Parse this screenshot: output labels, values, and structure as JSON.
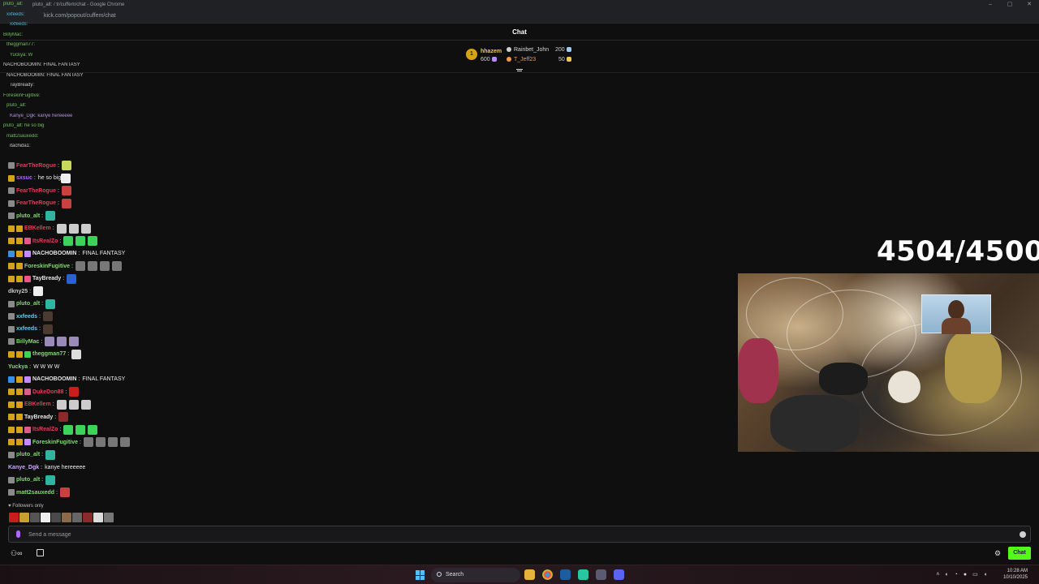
{
  "browser": {
    "window_title": "pluto_alt: / tr/cuffem/chat - Google Chrome",
    "url": "kick.com/popout/cuffem/chat",
    "controls": [
      "–",
      "▢",
      "✕"
    ]
  },
  "chat": {
    "title": "Chat",
    "leaderboard": {
      "rank": "1",
      "entries": [
        {
          "name": "hhazem",
          "value": "600",
          "color": "#f2c94c"
        },
        {
          "name": "Rainbet_John",
          "value": "200",
          "color": "#d6d6d6"
        },
        {
          "name": "T_Jeff23",
          "value": "50",
          "color": "#f2994a"
        }
      ]
    },
    "ghost_lines": [
      {
        "text": "pluto_alt:",
        "color": "#7fdc6a"
      },
      {
        "text": "xxfeeds:",
        "color": "#58d3f7"
      },
      {
        "text": "xxfeeds:",
        "color": "#58d3f7"
      },
      {
        "text": "BillyMac:",
        "color": "#7fdc6a"
      },
      {
        "text": "theggman77:",
        "color": "#7fdc6a"
      },
      {
        "text": "Yuckya: W",
        "color": "#7fdc6a"
      },
      {
        "text": "NACHOBOOMIN: FINAL FANTASY",
        "color": "#e6e6e6"
      },
      {
        "text": "NACHOBOOMIN: FINAL FANTASY",
        "color": "#e6e6e6"
      },
      {
        "text": "TayBready:",
        "color": "#e6e6e6"
      },
      {
        "text": "ForeskinFugitive:",
        "color": "#7fdc6a"
      },
      {
        "text": "pluto_alt:",
        "color": "#7fdc6a"
      },
      {
        "text": "Kanye_Dgk: kanye hereeeee",
        "color": "#c9a8ff"
      },
      {
        "text": "pluto_alt: he so big",
        "color": "#7fdc6a"
      },
      {
        "text": "matt2sauxedd:",
        "color": "#7fdc6a"
      },
      {
        "text": "itachida1:",
        "color": "#e6e6e6"
      }
    ],
    "messages": [
      {
        "user": "FearTheRogue",
        "color": "#e33b5c",
        "text": "",
        "badges": [
          "#8a8a8a"
        ],
        "emotes": [
          "#c8d85a"
        ]
      },
      {
        "user": "sxsuc",
        "color": "#b266ff",
        "text": "he so big",
        "badges": [
          "#d6a318"
        ],
        "emotes": [
          "#eeeeee"
        ]
      },
      {
        "user": "FearTheRogue",
        "color": "#e33b5c",
        "text": "",
        "badges": [
          "#8a8a8a"
        ],
        "emotes": [
          "#c84040"
        ]
      },
      {
        "user": "FearTheRogue",
        "color": "#e33b5c",
        "text": "",
        "badges": [
          "#8a8a8a"
        ],
        "emotes": [
          "#c84040"
        ]
      },
      {
        "user": "pluto_alt",
        "color": "#7fdc6a",
        "text": "",
        "badges": [
          "#8a8a8a"
        ],
        "emotes": [
          "#2fb5a0"
        ]
      },
      {
        "user": "EBKellem",
        "color": "#e33b5c",
        "text": "",
        "badges": [
          "#d6a318",
          "#d6a318"
        ],
        "emotes": [
          "#cccccc",
          "#cccccc",
          "#cccccc"
        ]
      },
      {
        "user": "ItsRealZo",
        "color": "#e33b5c",
        "text": "",
        "badges": [
          "#d6a318",
          "#d6a318",
          "#e05a8a"
        ],
        "emotes": [
          "#3bd35a",
          "#3bd35a",
          "#3bd35a"
        ]
      },
      {
        "user": "NACHOBOOMIN",
        "color": "#e6e6e6",
        "text": "FINAL FANTASY",
        "badges": [
          "#3a8ee6",
          "#d6a318",
          "#c48bff"
        ],
        "emotes": []
      },
      {
        "user": "ForeskinFugitive",
        "color": "#7fdc6a",
        "text": "",
        "badges": [
          "#d6a318",
          "#d6a318"
        ],
        "emotes": [
          "#777777",
          "#777777",
          "#777777",
          "#777777"
        ]
      },
      {
        "user": "TayBready",
        "color": "#e6e6e6",
        "text": "",
        "badges": [
          "#d6a318",
          "#d6a318",
          "#e05a8a"
        ],
        "emotes": [
          "#2a60d0"
        ]
      },
      {
        "user": "dkny25",
        "color": "#c9c9c9",
        "text": "",
        "badges": [],
        "emotes": [
          "#eeeeee"
        ]
      },
      {
        "user": "pluto_alt",
        "color": "#7fdc6a",
        "text": "",
        "badges": [
          "#8a8a8a"
        ],
        "emotes": [
          "#2fb5a0"
        ]
      },
      {
        "user": "xxfeeds",
        "color": "#58d3f7",
        "text": "",
        "badges": [
          "#8a8a8a"
        ],
        "emotes": [
          "#4a3a30"
        ]
      },
      {
        "user": "xxfeeds",
        "color": "#58d3f7",
        "text": "",
        "badges": [
          "#8a8a8a"
        ],
        "emotes": [
          "#4a3a30"
        ]
      },
      {
        "user": "BillyMac",
        "color": "#7fdc6a",
        "text": "",
        "badges": [
          "#8a8a8a"
        ],
        "emotes": [
          "#9a8ab8",
          "#9a8ab8",
          "#9a8ab8"
        ]
      },
      {
        "user": "theggman77",
        "color": "#7fdc6a",
        "text": "",
        "badges": [
          "#d6a318",
          "#d6a318",
          "#3bd35a"
        ],
        "emotes": [
          "#dddddd"
        ]
      },
      {
        "user": "Yuckya",
        "color": "#7fdc6a",
        "text": "W W W W",
        "badges": [],
        "emotes": []
      },
      {
        "user": "NACHOBOOMIN",
        "color": "#e6e6e6",
        "text": "FINAL FANTASY",
        "badges": [
          "#3a8ee6",
          "#d6a318",
          "#c48bff"
        ],
        "emotes": []
      },
      {
        "user": "DukeDon88",
        "color": "#e33b5c",
        "text": "",
        "badges": [
          "#d6a318",
          "#d6a318",
          "#e05a8a"
        ],
        "emotes": [
          "#c81e1e"
        ]
      },
      {
        "user": "EBKellem",
        "color": "#e33b5c",
        "text": "",
        "badges": [
          "#d6a318",
          "#d6a318"
        ],
        "emotes": [
          "#cccccc",
          "#cccccc",
          "#cccccc"
        ]
      },
      {
        "user": "TayBready",
        "color": "#e6e6e6",
        "text": "",
        "badges": [
          "#d6a318",
          "#d6a318"
        ],
        "emotes": [
          "#8a2a2a"
        ]
      },
      {
        "user": "ItsRealZo",
        "color": "#e33b5c",
        "text": "",
        "badges": [
          "#d6a318",
          "#d6a318",
          "#e05a8a"
        ],
        "emotes": [
          "#3bd35a",
          "#3bd35a",
          "#3bd35a"
        ]
      },
      {
        "user": "ForeskinFugitive",
        "color": "#7fdc6a",
        "text": "",
        "badges": [
          "#d6a318",
          "#d6a318",
          "#c48bff"
        ],
        "emotes": [
          "#777777",
          "#777777",
          "#777777",
          "#777777"
        ]
      },
      {
        "user": "pluto_alt",
        "color": "#7fdc6a",
        "text": "",
        "badges": [
          "#8a8a8a"
        ],
        "emotes": [
          "#2fb5a0"
        ]
      },
      {
        "user": "Kanye_Dgk",
        "color": "#c9a8ff",
        "text": "kanye hereeeee",
        "badges": [],
        "emotes": []
      },
      {
        "user": "pluto_alt",
        "color": "#7fdc6a",
        "text": "",
        "badges": [
          "#8a8a8a"
        ],
        "emotes": [
          "#2fb5a0"
        ]
      },
      {
        "user": "matt2sauxedd",
        "color": "#7fdc6a",
        "text": "",
        "badges": [
          "#8a8a8a"
        ],
        "emotes": [
          "#c84040"
        ]
      }
    ],
    "followers_only": "Followers only",
    "emote_strip": [
      "#c81e1e",
      "#c8a030",
      "#555555",
      "#eeeeee",
      "#4a4a4a",
      "#8a6a4a",
      "#666666",
      "#8a2a2a",
      "#dddddd",
      "#777777"
    ],
    "input_placeholder": "Send a message",
    "send_label": "Chat",
    "accent_color": "#53fc18"
  },
  "stream": {
    "goal_counter": "4504/4500"
  },
  "taskbar": {
    "search_label": "Search",
    "time": "10:28 AM",
    "date": "10/10/2025"
  }
}
